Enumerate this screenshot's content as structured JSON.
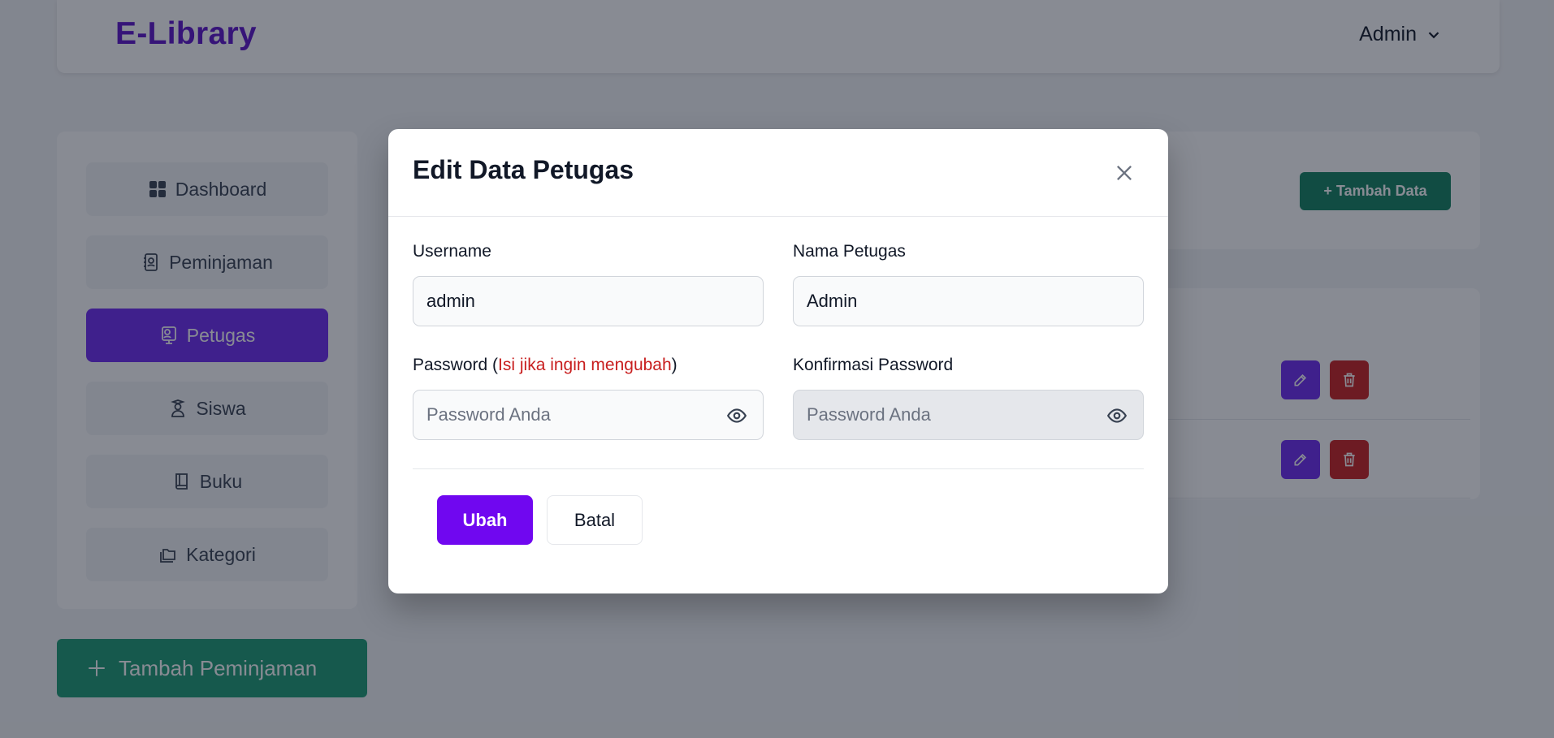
{
  "app": {
    "brand": "E-Library",
    "user_menu_label": "Admin"
  },
  "sidebar": {
    "items": [
      {
        "label": "Dashboard",
        "icon": "grid-icon"
      },
      {
        "label": "Peminjaman",
        "icon": "contact-book-icon"
      },
      {
        "label": "Petugas",
        "icon": "officer-icon",
        "active": true
      },
      {
        "label": "Siswa",
        "icon": "student-icon"
      },
      {
        "label": "Buku",
        "icon": "book-icon"
      },
      {
        "label": "Kategori",
        "icon": "folders-icon"
      }
    ],
    "add_loan_label": "Tambah Peminjaman"
  },
  "main": {
    "add_data_label": "+ Tambah Data"
  },
  "modal": {
    "title": "Edit Data Petugas",
    "username_label": "Username",
    "username_value": "admin",
    "name_label": "Nama Petugas",
    "name_value": "Admin",
    "password_label": "Password (",
    "password_hint": "Isi jika ingin mengubah",
    "password_label_close": ")",
    "password_placeholder": "Password Anda",
    "confirm_label": "Konfirmasi Password",
    "confirm_placeholder": "Password Anda",
    "submit_label": "Ubah",
    "cancel_label": "Batal"
  },
  "colors": {
    "brand": "#5b10c9",
    "primary": "#7007f0",
    "success": "#1a9b72",
    "danger": "#c81e1e",
    "overlay": "rgba(17,24,39,0.5)"
  }
}
